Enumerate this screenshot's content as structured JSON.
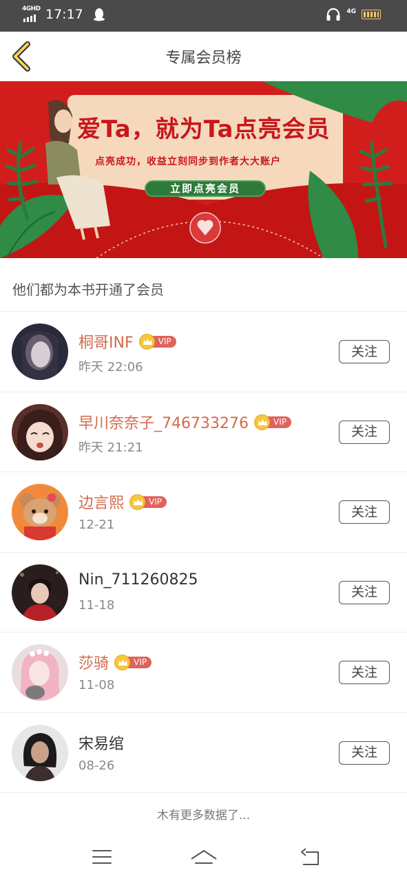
{
  "status_bar": {
    "network_label": "4GHD",
    "time": "17:17",
    "right_network": "4G"
  },
  "header": {
    "title": "专属会员榜",
    "back_icon": "chevron-left-icon"
  },
  "banner": {
    "title": "爱Ta，就为Ta点亮会员",
    "subtitle": "点亮成功，收益立刻同步到作者大大账户",
    "cta_label": "立即点亮会员",
    "colors": {
      "background": "#d21d1d",
      "card": "#f6d9bd",
      "cta": "#2d7a3a"
    }
  },
  "section": {
    "title": "他们都为本书开通了会员"
  },
  "members": [
    {
      "name": "桐哥INF",
      "vip": true,
      "vip_label": "VIP",
      "time": "昨天 22:06",
      "follow_label": "关注",
      "avatar_icon": "avatar-dark-portrait"
    },
    {
      "name": "早川奈奈子_746733276",
      "vip": true,
      "vip_label": "VIP",
      "time": "昨天 21:21",
      "follow_label": "关注",
      "avatar_icon": "avatar-anime-girl"
    },
    {
      "name": "边言熙",
      "vip": true,
      "vip_label": "VIP",
      "time": "12-21",
      "follow_label": "关注",
      "avatar_icon": "avatar-bear"
    },
    {
      "name": "Nin_711260825",
      "vip": false,
      "vip_label": "",
      "time": "11-18",
      "follow_label": "关注",
      "avatar_icon": "avatar-boy-red"
    },
    {
      "name": "莎骑",
      "vip": true,
      "vip_label": "VIP",
      "time": "11-08",
      "follow_label": "关注",
      "avatar_icon": "avatar-pink-hair"
    },
    {
      "name": "宋易绾",
      "vip": false,
      "vip_label": "",
      "time": "08-26",
      "follow_label": "关注",
      "avatar_icon": "avatar-woman-dark"
    }
  ],
  "footer": {
    "end_text": "木有更多数据了..."
  },
  "nav": {
    "menu_icon": "menu-icon",
    "home_icon": "home-icon",
    "back_icon": "back-icon"
  },
  "colors": {
    "vip_name": "#d36a4b",
    "vip_badge": "#e0625a",
    "divider": "#ececec"
  }
}
